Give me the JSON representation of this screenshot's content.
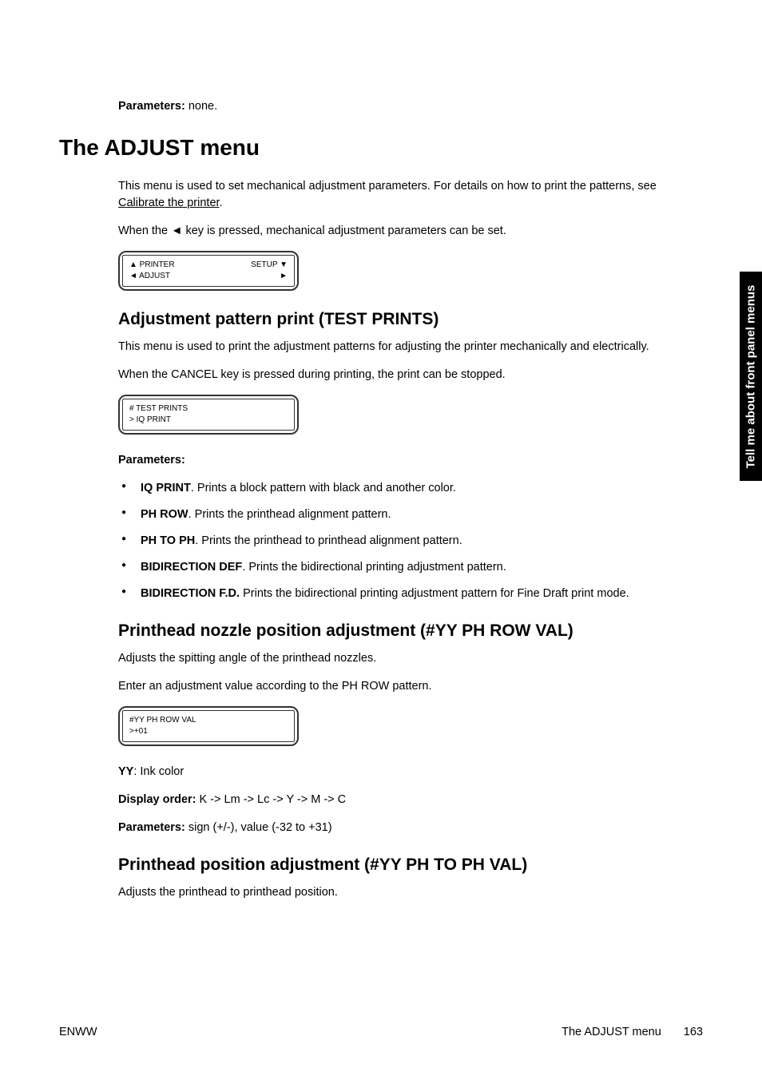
{
  "intro": {
    "parameters_label": "Parameters:",
    "parameters_value": " none."
  },
  "heading_main": "The ADJUST menu",
  "intro_text_1a": "This menu is used to set mechanical adjustment parameters. For details on how to print the patterns, see ",
  "intro_text_1_link": "Calibrate the printer",
  "intro_text_1b": ".",
  "intro_text_2a": "When the ",
  "intro_text_2_key": "◄",
  "intro_text_2b": " key is pressed, mechanical adjustment parameters can be set.",
  "lcd1": {
    "row1_left": "▲ PRINTER",
    "row1_right": "SETUP ▼",
    "row2_left": "◄ ADJUST",
    "row2_right": "►"
  },
  "section1": {
    "heading": "Adjustment pattern print (TEST PRINTS)",
    "p1": "This menu is used to print the adjustment patterns for adjusting the printer mechanically and electrically.",
    "p2": "When the CANCEL key is pressed during printing, the print can be stopped.",
    "lcd": {
      "row1": "# TEST PRINTS",
      "row2": "> IQ PRINT"
    },
    "parameters_label": "Parameters:",
    "items": [
      {
        "name": "IQ PRINT",
        "desc": ". Prints a block pattern with black and another color."
      },
      {
        "name": "PH ROW",
        "desc": ". Prints the printhead alignment pattern."
      },
      {
        "name": "PH TO PH",
        "desc": ". Prints the printhead to printhead alignment pattern."
      },
      {
        "name": "BIDIRECTION DEF",
        "desc": ". Prints the bidirectional printing adjustment pattern."
      },
      {
        "name": "BIDIRECTION F.D.",
        "desc": " Prints the bidirectional printing adjustment pattern for Fine Draft print mode."
      }
    ]
  },
  "section2": {
    "heading": "Printhead nozzle position adjustment (#YY PH ROW VAL)",
    "p1": "Adjusts the spitting angle of the printhead nozzles.",
    "p2": "Enter an adjustment value according to the PH ROW pattern.",
    "lcd": {
      "row1": "#YY PH ROW VAL",
      "row2": ">+01"
    },
    "yy_label": "YY",
    "yy_desc": ": Ink color",
    "display_order_label": "Display order:",
    "display_order_value": " K -> Lm -> Lc -> Y -> M -> C",
    "parameters_label": "Parameters:",
    "parameters_value": " sign (+/-), value (-32 to +31)"
  },
  "section3": {
    "heading": "Printhead position adjustment (#YY PH TO PH VAL)",
    "p1": "Adjusts the printhead to printhead position."
  },
  "sidebar_text": "Tell me about front panel menus",
  "footer": {
    "left": "ENWW",
    "right_title": "The ADJUST menu",
    "page_number": "163"
  }
}
